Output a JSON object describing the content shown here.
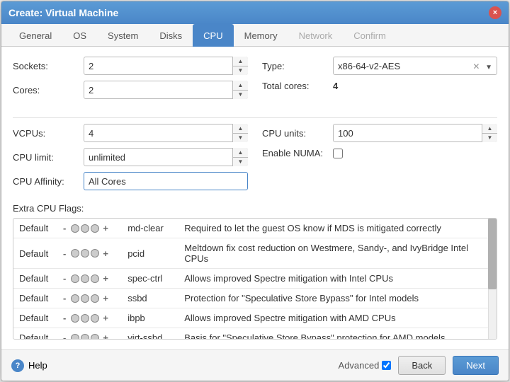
{
  "dialog": {
    "title": "Create: Virtual Machine",
    "close_label": "×"
  },
  "tabs": [
    {
      "id": "general",
      "label": "General",
      "state": "normal"
    },
    {
      "id": "os",
      "label": "OS",
      "state": "normal"
    },
    {
      "id": "system",
      "label": "System",
      "state": "normal"
    },
    {
      "id": "disks",
      "label": "Disks",
      "state": "normal"
    },
    {
      "id": "cpu",
      "label": "CPU",
      "state": "active"
    },
    {
      "id": "memory",
      "label": "Memory",
      "state": "normal"
    },
    {
      "id": "network",
      "label": "Network",
      "state": "disabled"
    },
    {
      "id": "confirm",
      "label": "Confirm",
      "state": "disabled"
    }
  ],
  "cpu_form": {
    "sockets_label": "Sockets:",
    "sockets_value": "2",
    "type_label": "Type:",
    "type_value": "x86-64-v2-AES",
    "cores_label": "Cores:",
    "cores_value": "2",
    "total_cores_label": "Total cores:",
    "total_cores_value": "4",
    "vcpus_label": "VCPUs:",
    "vcpus_value": "4",
    "cpu_units_label": "CPU units:",
    "cpu_units_value": "100",
    "cpu_limit_label": "CPU limit:",
    "cpu_limit_value": "unlimited",
    "enable_numa_label": "Enable NUMA:",
    "cpu_affinity_label": "CPU Affinity:",
    "cpu_affinity_value": "All Cores",
    "extra_flags_label": "Extra CPU Flags:"
  },
  "flags": [
    {
      "default": "Default",
      "dots": [
        0,
        0,
        0
      ],
      "name": "md-clear",
      "description": "Required to let the guest OS know if MDS is mitigated correctly"
    },
    {
      "default": "Default",
      "dots": [
        0,
        0,
        0
      ],
      "name": "pcid",
      "description": "Meltdown fix cost reduction on Westmere, Sandy-, and IvyBridge Intel CPUs"
    },
    {
      "default": "Default",
      "dots": [
        0,
        0,
        0
      ],
      "name": "spec-ctrl",
      "description": "Allows improved Spectre mitigation with Intel CPUs"
    },
    {
      "default": "Default",
      "dots": [
        0,
        0,
        0
      ],
      "name": "ssbd",
      "description": "Protection for \"Speculative Store Bypass\" for Intel models"
    },
    {
      "default": "Default",
      "dots": [
        0,
        0,
        0
      ],
      "name": "ibpb",
      "description": "Allows improved Spectre mitigation with AMD CPUs"
    },
    {
      "default": "Default",
      "dots": [
        0,
        0,
        0
      ],
      "name": "virt-ssbd",
      "description": "Basis for \"Speculative Store Bypass\" protection for AMD models"
    }
  ],
  "footer": {
    "help_label": "Help",
    "advanced_label": "Advanced",
    "back_label": "Back",
    "next_label": "Next"
  }
}
